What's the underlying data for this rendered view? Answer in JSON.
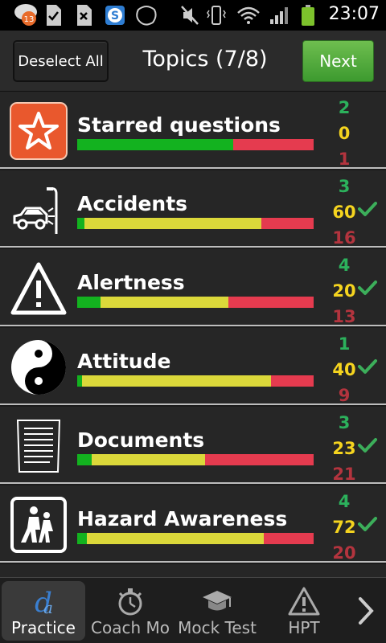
{
  "status_bar": {
    "notification_count": "13",
    "time": "23:07"
  },
  "header": {
    "deselect_label": "Deselect All",
    "title": "Topics (7/8)",
    "next_label": "Next"
  },
  "topics": [
    {
      "name": "Starred questions",
      "correct": "2",
      "partial": "0",
      "wrong": "1",
      "checked": false,
      "bar": {
        "green": 0.66,
        "yellow": 0,
        "red": 0.34
      }
    },
    {
      "name": "Accidents",
      "correct": "3",
      "partial": "60",
      "wrong": "16",
      "checked": true,
      "bar": {
        "green": 0.03,
        "yellow": 0.75,
        "red": 0.22
      }
    },
    {
      "name": "Alertness",
      "correct": "4",
      "partial": "20",
      "wrong": "13",
      "checked": true,
      "bar": {
        "green": 0.1,
        "yellow": 0.54,
        "red": 0.36
      }
    },
    {
      "name": "Attitude",
      "correct": "1",
      "partial": "40",
      "wrong": "9",
      "checked": true,
      "bar": {
        "green": 0.02,
        "yellow": 0.8,
        "red": 0.18
      }
    },
    {
      "name": "Documents",
      "correct": "3",
      "partial": "23",
      "wrong": "21",
      "checked": true,
      "bar": {
        "green": 0.06,
        "yellow": 0.48,
        "red": 0.46
      }
    },
    {
      "name": "Hazard Awareness",
      "correct": "4",
      "partial": "72",
      "wrong": "20",
      "checked": true,
      "bar": {
        "green": 0.04,
        "yellow": 0.75,
        "red": 0.21
      }
    }
  ],
  "tabs": [
    {
      "label": "Practice",
      "icon": "practice-icon",
      "active": true
    },
    {
      "label": "Coach Mo",
      "icon": "stopwatch-icon",
      "active": false
    },
    {
      "label": "Mock Test",
      "icon": "graduation-cap-icon",
      "active": false
    },
    {
      "label": "HPT",
      "icon": "warning-icon",
      "active": false
    }
  ],
  "colors": {
    "correct": "#2cb15c",
    "partial": "#f5d41f",
    "wrong": "#b3343e",
    "accent_green": "#4caf3a"
  }
}
